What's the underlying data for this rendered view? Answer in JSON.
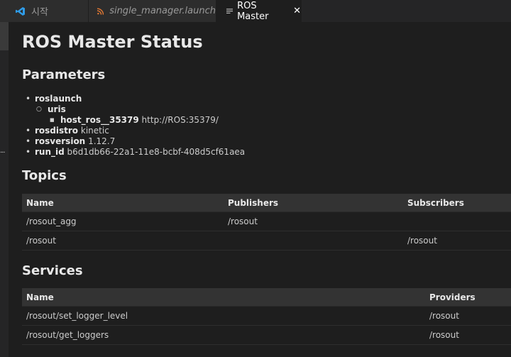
{
  "tabs": [
    {
      "label": "시작",
      "icon": "vscode-icon"
    },
    {
      "label": "single_manager.launch",
      "icon": "rss-icon"
    },
    {
      "label": "ROS Master",
      "icon": "preview-icon",
      "close": "✕"
    }
  ],
  "gutter": {
    "dots": "..."
  },
  "page": {
    "title": "ROS Master Status",
    "parameters_heading": "Parameters",
    "topics_heading": "Topics",
    "services_heading": "Services"
  },
  "parameters": {
    "roslaunch": {
      "key": "roslaunch",
      "uris": {
        "key": "uris",
        "host": {
          "key": "host_ros__35379",
          "value": "http://ROS:35379/"
        }
      }
    },
    "rosdistro": {
      "key": "rosdistro",
      "value": "kinetic"
    },
    "rosversion": {
      "key": "rosversion",
      "value": "1.12.7"
    },
    "run_id": {
      "key": "run_id",
      "value": "b6d1db66-22a1-11e8-bcbf-408d5cf61aea"
    }
  },
  "topics": {
    "headers": [
      "Name",
      "Publishers",
      "Subscribers"
    ],
    "rows": [
      [
        "/rosout_agg",
        "/rosout",
        ""
      ],
      [
        "/rosout",
        "",
        "/rosout"
      ]
    ]
  },
  "services": {
    "headers": [
      "Name",
      "Providers"
    ],
    "rows": [
      [
        "/rosout/set_logger_level",
        "/rosout"
      ],
      [
        "/rosout/get_loggers",
        "/rosout"
      ]
    ]
  },
  "colors": {
    "background": "#1e1e1e",
    "tabbar": "#252526",
    "table_header": "#333333",
    "rss_orange": "#e37933",
    "vscode_blue": "#2f9ce8"
  }
}
